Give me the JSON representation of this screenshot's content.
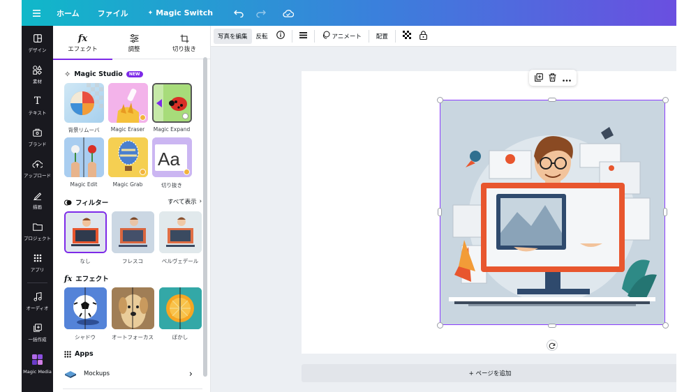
{
  "topbar": {
    "menu_icon": "hamburger-menu-icon",
    "home": "ホーム",
    "file": "ファイル",
    "magic_switch": "Magic Switch",
    "undo_icon": "undo-icon",
    "redo_icon": "redo-icon",
    "cloud_icon": "cloud-save-icon"
  },
  "rail": {
    "items": [
      {
        "label": "デザイン",
        "icon": "layout-icon"
      },
      {
        "label": "素材",
        "icon": "shapes-icon"
      },
      {
        "label": "テキスト",
        "icon": "text-icon"
      },
      {
        "label": "ブランド",
        "icon": "brand-icon"
      },
      {
        "label": "アップロード",
        "icon": "upload-icon"
      },
      {
        "label": "描画",
        "icon": "draw-icon"
      },
      {
        "label": "プロジェクト",
        "icon": "folder-icon"
      },
      {
        "label": "アプリ",
        "icon": "apps-icon"
      },
      {
        "label": "オーディオ",
        "icon": "music-icon"
      },
      {
        "label": "一括作成",
        "icon": "bulk-create-icon"
      },
      {
        "label": "Magic Media",
        "icon": "magic-media-icon"
      }
    ]
  },
  "panel": {
    "tabs": [
      {
        "label": "エフェクト",
        "icon": "fx-icon"
      },
      {
        "label": "調整",
        "icon": "sliders-icon"
      },
      {
        "label": "切り抜き",
        "icon": "crop-icon"
      }
    ],
    "magic_studio": {
      "title": "Magic Studio",
      "badge": "NEW",
      "tools": [
        "背景リムーバ",
        "Magic Eraser",
        "Magic Expand",
        "Magic Edit",
        "Magic Grab",
        "切り抜き"
      ]
    },
    "filters": {
      "title": "フィルター",
      "see_all": "すべて表示",
      "items": [
        "なし",
        "フレスコ",
        "ベルヴェデール"
      ]
    },
    "effects": {
      "title": "エフェクト",
      "items": [
        "シャドウ",
        "オートフォーカス",
        "ぼかし"
      ]
    },
    "apps": {
      "title": "Apps",
      "items": [
        {
          "label": "Mockups"
        }
      ]
    },
    "fx_glyph": "fx"
  },
  "toolbar": {
    "edit_photo": "写真を編集",
    "flip": "反転",
    "info_icon": "info-icon",
    "lines_icon": "border-style-icon",
    "animate": "アニメート",
    "position": "配置",
    "transparency_icon": "transparency-icon",
    "lock_icon": "lock-icon"
  },
  "canvas": {
    "add_page": "+ ページを追加",
    "rotate_icon": "rotate-icon",
    "float_menu": [
      "duplicate-icon",
      "trash-icon",
      "more-icon"
    ]
  },
  "colors": {
    "accent": "#7d2ae8",
    "rail_bg": "#19191f",
    "selection": "#8b3dff"
  }
}
